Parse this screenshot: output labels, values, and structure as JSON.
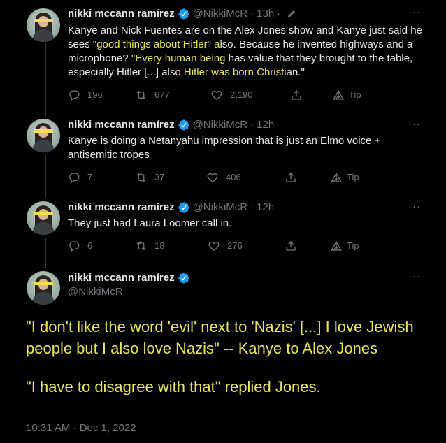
{
  "author": {
    "name": "nikki mccann ramírez",
    "handle": "@NikkiMcR"
  },
  "colors": {
    "background": "#000000",
    "text": "#e7e9ea",
    "muted": "#71767b",
    "highlight": "#e7e45a",
    "verified": "#1d9bf0"
  },
  "tweets": [
    {
      "time": "13h",
      "dot": "·",
      "segments": [
        {
          "t": "Kanye and Nick Fuentes are on the Alex Jones show and Kanye just said he sees \"",
          "hl": false
        },
        {
          "t": "good things about Hitler",
          "hl": true
        },
        {
          "t": "\" ",
          "hl": false
        },
        {
          "t": "a",
          "hl": true
        },
        {
          "t": "lso. Because he invented highways and a microphone? ",
          "hl": false
        },
        {
          "t": "\"Every human being",
          "hl": true
        },
        {
          "t": " has value that they brought to the table, especially Hitler [...] also ",
          "hl": false
        },
        {
          "t": "Hitler was born Christi",
          "hl": true
        },
        {
          "t": "an.\"",
          "hl": false
        }
      ],
      "replies": "196",
      "retweets": "677",
      "likes": "2,190",
      "tip": "Tip"
    },
    {
      "time": "12h",
      "dot": "·",
      "segments": [
        {
          "t": "Kanye is doing a Netanyahu impression that is just an Elmo voice + antisemitic tropes",
          "hl": false
        }
      ],
      "replies": "7",
      "retweets": "37",
      "likes": "406",
      "tip": "Tip"
    },
    {
      "time": "12h",
      "dot": "·",
      "segments": [
        {
          "t": "They just had Laura Loomer call in.",
          "hl": false
        }
      ],
      "replies": "6",
      "retweets": "18",
      "likes": "276",
      "tip": "Tip"
    }
  ],
  "main_tweet": {
    "paragraph1": "\"I don't like the word 'evil' next to 'Nazis' [...] I love Jewish people but I also love Nazis\" -- Kanye to Alex Jones",
    "paragraph2": "\"I have to disagree with that\" replied Jones.",
    "timestamp": "10:31 AM · Dec 1, 2022"
  },
  "icons": {
    "reply": "reply-icon",
    "retweet": "retweet-icon",
    "like": "heart-icon",
    "share": "share-icon",
    "tip": "tip-icon",
    "more": "more-icon",
    "verified": "verified-badge-icon",
    "edited": "edit-pencil-icon"
  },
  "more_glyph": "···"
}
